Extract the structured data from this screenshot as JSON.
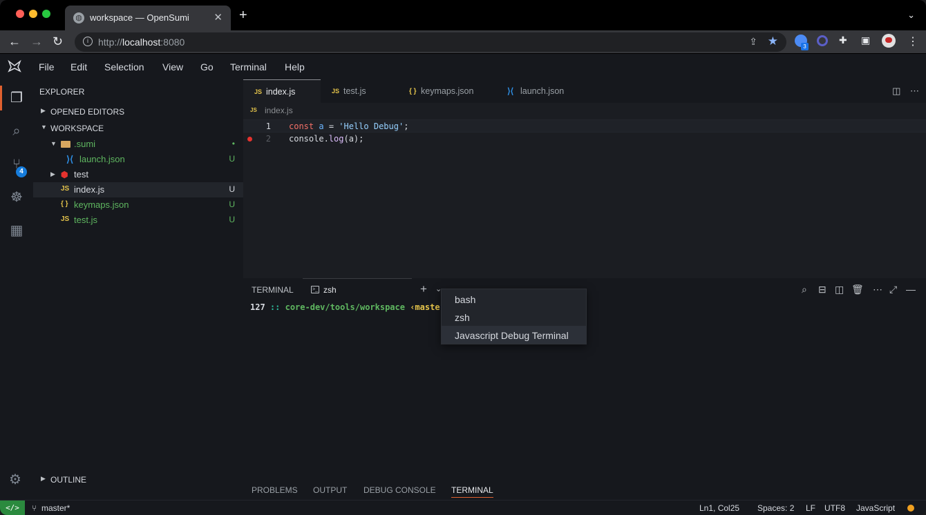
{
  "browser": {
    "tab_title": "workspace — OpenSumi",
    "url_prefix": "http://",
    "url_host": "localhost",
    "url_port": ":8080",
    "extension_badge": "3"
  },
  "menu": [
    "File",
    "Edit",
    "Selection",
    "View",
    "Go",
    "Terminal",
    "Help"
  ],
  "activity": {
    "scm_badge": "4"
  },
  "explorer": {
    "title": "EXPLORER",
    "opened_editors": "OPENED EDITORS",
    "workspace": "WORKSPACE",
    "tree": [
      {
        "name": ".sumi",
        "status": "•",
        "kind": "folder"
      },
      {
        "name": "launch.json",
        "status": "U",
        "kind": "vscode",
        "icon": ""
      },
      {
        "name": "test",
        "status": "",
        "kind": "folder"
      },
      {
        "name": "index.js",
        "status": "U",
        "kind": "js",
        "icon": "JS"
      },
      {
        "name": "keymaps.json",
        "status": "U",
        "kind": "json",
        "icon": "{ }"
      },
      {
        "name": "test.js",
        "status": "U",
        "kind": "js",
        "icon": "JS"
      }
    ],
    "outline": "OUTLINE"
  },
  "editor": {
    "tabs": [
      {
        "label": "index.js",
        "icon": "JS"
      },
      {
        "label": "test.js",
        "icon": "JS"
      },
      {
        "label": "keymaps.json",
        "icon": "{ }"
      },
      {
        "label": "launch.json",
        "icon": ""
      }
    ],
    "breadcrumb": "index.js",
    "breadcrumb_icon": "JS",
    "lines": [
      {
        "num": "1",
        "kw": "const",
        "var": "a",
        "op": " = ",
        "str": "'Hello Debug'",
        "end": ";"
      },
      {
        "num": "2",
        "obj": "console.",
        "fn": "log",
        "rest": "(a);"
      }
    ]
  },
  "panel": {
    "title": "TERMINAL",
    "tab_label": "zsh",
    "prompt": {
      "num": "127",
      "sep": " :: ",
      "path": "core-dev/tools/workspace",
      "branch": " ‹master›"
    },
    "dropdown": [
      "bash",
      "zsh",
      "Javascript Debug Terminal"
    ]
  },
  "bottom_tabs": [
    "PROBLEMS",
    "OUTPUT",
    "DEBUG CONSOLE",
    "TERMINAL"
  ],
  "status": {
    "remote": "</>",
    "branch": "master*",
    "position": "Ln1,  Col25",
    "spaces": "Spaces: 2",
    "eol": "LF",
    "encoding": "UTF8",
    "language": "JavaScript"
  }
}
